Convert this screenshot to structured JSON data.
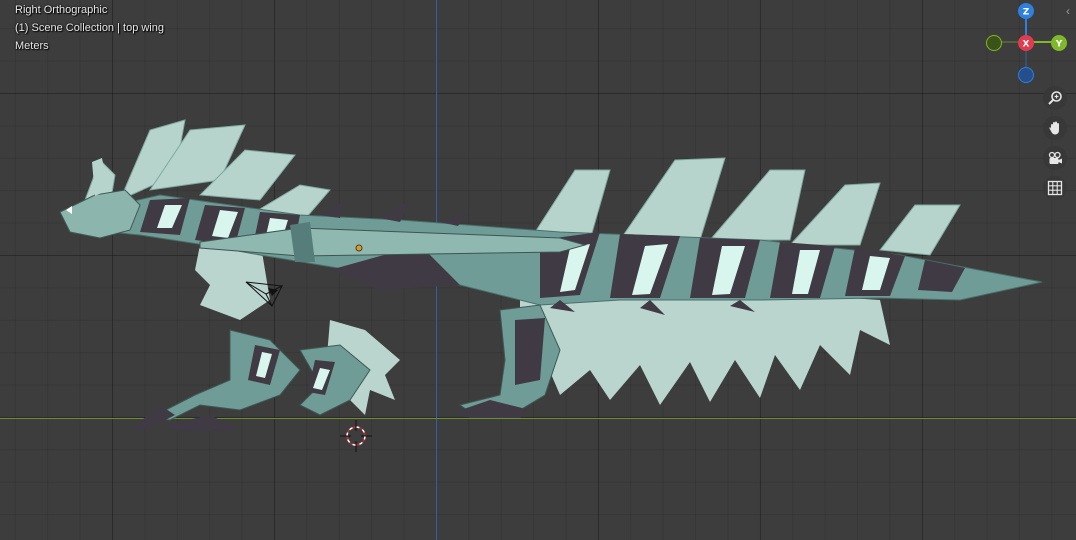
{
  "viewport": {
    "view_name": "Right Orthographic",
    "collection_line": "(1) Scene Collection | top wing",
    "units": "Meters"
  },
  "gizmo": {
    "z_label": "Z",
    "x_label": "X",
    "y_label": "Y",
    "colors": {
      "z": "#2f7fe0",
      "x": "#e23a4e",
      "y": "#7fb82a"
    }
  },
  "nav_buttons": [
    {
      "name": "zoom",
      "icon": "zoom-magnifier-icon"
    },
    {
      "name": "pan",
      "icon": "hand-icon"
    },
    {
      "name": "camera",
      "icon": "camera-icon"
    },
    {
      "name": "grid",
      "icon": "grid-icon"
    }
  ],
  "colors": {
    "background": "#3d3d3d",
    "axis_blue": "#2f5fb0",
    "axis_green": "#6b8e2e",
    "model_light": "#a9cbc3",
    "model_mid": "#6f9c96",
    "model_dark": "#3f3a44",
    "glow": "#d8f6ee"
  }
}
